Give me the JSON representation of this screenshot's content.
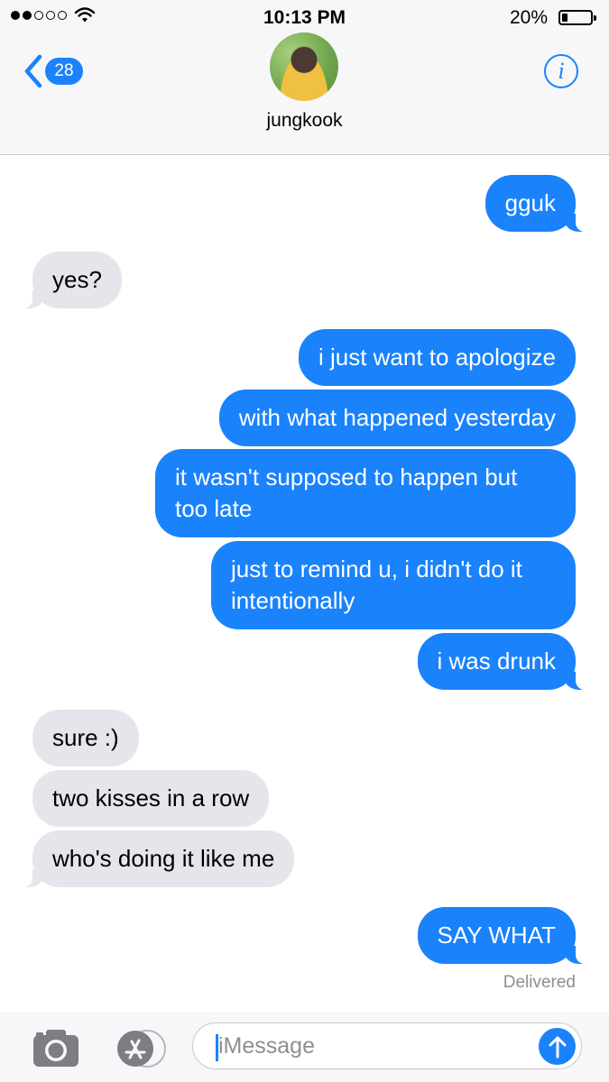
{
  "status_bar": {
    "time": "10:13 PM",
    "battery_percent": "20%",
    "battery_level": 0.2,
    "signal_bars_filled": 2,
    "signal_bars_total": 5
  },
  "header": {
    "back_badge": "28",
    "contact_name": "jungkook",
    "info_icon": "i"
  },
  "messages": [
    {
      "direction": "outgoing",
      "text": "gguk"
    },
    {
      "direction": "incoming",
      "text": "yes?"
    },
    {
      "direction": "outgoing",
      "text": "i just want to apologize"
    },
    {
      "direction": "outgoing",
      "text": "with what happened yesterday"
    },
    {
      "direction": "outgoing",
      "text": "it wasn't supposed to happen but too late"
    },
    {
      "direction": "outgoing",
      "text": "just to remind u, i didn't do it intentionally"
    },
    {
      "direction": "outgoing",
      "text": "i was drunk"
    },
    {
      "direction": "incoming",
      "text": "sure :)"
    },
    {
      "direction": "incoming",
      "text": "two kisses in a row"
    },
    {
      "direction": "incoming",
      "text": "who's doing it like me"
    },
    {
      "direction": "outgoing",
      "text": "SAY WHAT"
    }
  ],
  "delivery_status": "Delivered",
  "input": {
    "placeholder": "iMessage",
    "value": ""
  },
  "icons": [
    "wifi-icon",
    "battery-icon",
    "chevron-left-icon",
    "info-icon",
    "camera-icon",
    "app-store-icon",
    "send-arrow-icon"
  ],
  "colors": {
    "accent": "#1a82fb",
    "incoming_bubble": "#e6e5eb",
    "header_bg": "#f7f7f9",
    "secondary_text": "#8e8e93"
  }
}
